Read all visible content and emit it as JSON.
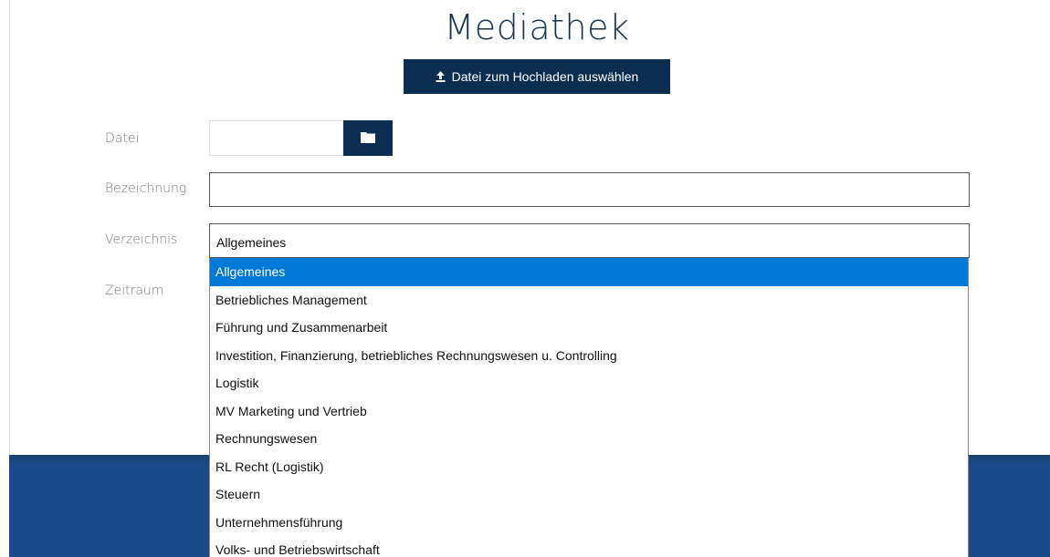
{
  "page": {
    "title": "Mediathek"
  },
  "upload": {
    "button_label": "Datei zum Hochladen auswählen",
    "icon": "upload-icon"
  },
  "form": {
    "file": {
      "label": "Datei",
      "value": "",
      "browse_icon": "folder-icon"
    },
    "name": {
      "label": "Bezeichnung",
      "value": ""
    },
    "directory": {
      "label": "Verzeichnis",
      "selected": "Allgemeines",
      "options": [
        "Allgemeines",
        "Betriebliches Management",
        "Führung und Zusammenarbeit",
        "Investition, Finanzierung, betriebliches Rechnungswesen u. Controlling",
        "Logistik",
        "MV Marketing und Vertrieb",
        "Rechnungswesen",
        "RL Recht (Logistik)",
        "Steuern",
        "Unternehmensführung",
        "Volks- und Betriebswirtschaft"
      ]
    },
    "period": {
      "label": "Zeitraum"
    }
  },
  "colors": {
    "primary_dark": "#0b2e50",
    "title": "#17344f",
    "footer": "#1b4a8a",
    "selection": "#0078d7"
  }
}
